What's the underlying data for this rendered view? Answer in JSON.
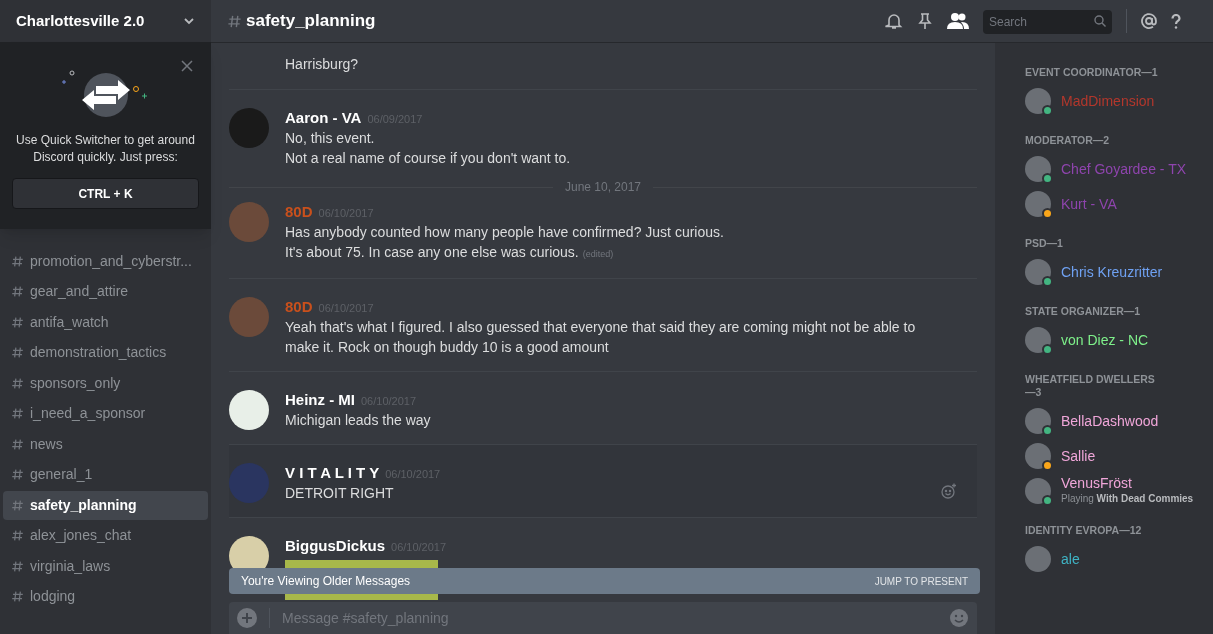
{
  "server": {
    "name": "Charlottesville 2.0"
  },
  "quick_switcher": {
    "text": "Use Quick Switcher to get around Discord quickly. Just press:",
    "shortcut": "CTRL + K"
  },
  "channels": [
    {
      "name": "promotion_and_cyberstr...",
      "selected": false
    },
    {
      "name": "gear_and_attire",
      "selected": false
    },
    {
      "name": "antifa_watch",
      "selected": false
    },
    {
      "name": "demonstration_tactics",
      "selected": false
    },
    {
      "name": "sponsors_only",
      "selected": false
    },
    {
      "name": "i_need_a_sponsor",
      "selected": false
    },
    {
      "name": "news",
      "selected": false
    },
    {
      "name": "general_1",
      "selected": false
    },
    {
      "name": "safety_planning",
      "selected": true
    },
    {
      "name": "alex_jones_chat",
      "selected": false
    },
    {
      "name": "virginia_laws",
      "selected": false
    },
    {
      "name": "lodging",
      "selected": false
    }
  ],
  "header": {
    "channel": "safety_planning",
    "search_placeholder": "Search"
  },
  "messages": [
    {
      "kind": "continuation",
      "lines": [
        "Harrisburg?"
      ]
    },
    {
      "kind": "message",
      "author": "Aaron - VA",
      "color": "#ffffff",
      "timestamp": "06/09/2017",
      "lines": [
        "No, this event.",
        "Not a real name of course if you don't want to."
      ],
      "hovered": false
    },
    {
      "kind": "divider",
      "label": "June 10, 2017"
    },
    {
      "kind": "message",
      "author": "80D",
      "color": "#c9501c",
      "timestamp": "06/10/2017",
      "lines": [
        "Has anybody counted how many people have confirmed? Just curious.",
        "It's about 75. In case any one else was curious."
      ],
      "edited": "(edited)",
      "hovered": false
    },
    {
      "kind": "message",
      "author": "80D",
      "color": "#c9501c",
      "timestamp": "06/10/2017",
      "lines": [
        "Yeah that's what I figured. I also guessed that everyone that said they are coming might not be able to make it. Rock on though buddy 10 is a good amount"
      ],
      "hovered": false
    },
    {
      "kind": "message",
      "author": "Heinz - MI",
      "color": "#ffffff",
      "timestamp": "06/10/2017",
      "lines": [
        "Michigan leads the way"
      ],
      "hovered": false
    },
    {
      "kind": "message",
      "author": "V I T A L I T Y",
      "color": "#ffffff",
      "timestamp": "06/10/2017",
      "lines": [
        "DETROIT RIGHT"
      ],
      "hovered": true
    },
    {
      "kind": "image",
      "author": "BiggusDickus",
      "color": "#ffffff",
      "timestamp": "06/10/2017"
    }
  ],
  "older_bar": {
    "text": "You're Viewing Older Messages",
    "action": "JUMP TO PRESENT"
  },
  "composer": {
    "placeholder": "Message #safety_planning"
  },
  "member_groups": [
    {
      "title": "EVENT COORDINATOR—1",
      "members": [
        {
          "name": "MadDimension",
          "color": "#b3372c",
          "idle": false
        }
      ]
    },
    {
      "title": "MODERATOR—2",
      "members": [
        {
          "name": "Chef Goyardee - TX",
          "color": "#8e44ad",
          "idle": false
        },
        {
          "name": "Kurt - VA",
          "color": "#8e44ad",
          "idle": true
        }
      ]
    },
    {
      "title": "PSD—1",
      "members": [
        {
          "name": "Chris Kreuzritter",
          "color": "#6fa1f2",
          "idle": false
        }
      ]
    },
    {
      "title": "STATE ORGANIZER—1",
      "members": [
        {
          "name": "von Diez - NC",
          "color": "#7ef08a",
          "idle": false
        }
      ]
    },
    {
      "title": "WHEATFIELD DWELLERS—3",
      "members": [
        {
          "name": "BellaDashwood",
          "color": "#f0a6d9",
          "idle": false
        },
        {
          "name": "Sallie",
          "color": "#f0a6d9",
          "idle": true
        },
        {
          "name": "VenusFröst",
          "color": "#f0a6d9",
          "idle": false,
          "activity": "Playing **With Dead Commies**"
        }
      ]
    },
    {
      "title": "IDENTITY EVROPA—12",
      "members": [
        {
          "name": "ale",
          "color": "#3fb3c4"
        }
      ]
    }
  ]
}
